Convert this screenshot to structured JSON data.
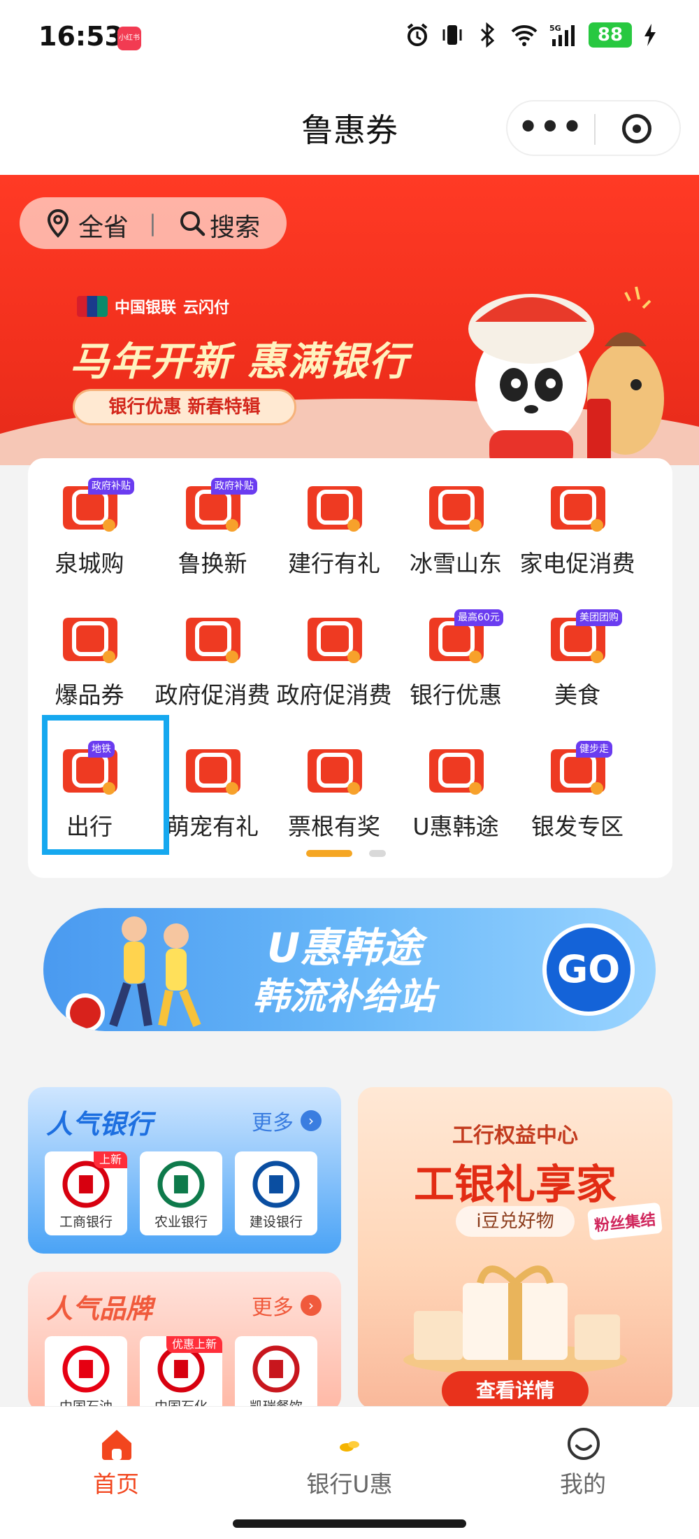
{
  "status_bar": {
    "time": "16:53",
    "app_badge": "小红书",
    "battery": "88",
    "network": "5G"
  },
  "header": {
    "title": "鲁惠券",
    "more_label": "•••"
  },
  "banner": {
    "location_label": "全省",
    "divider": "|",
    "search_label": "搜索",
    "logo_text_1": "中国银联",
    "logo_text_2": "云闪付",
    "main_text": "马年开新 惠满银行",
    "sub_text": "银行优惠 新春特辑"
  },
  "grid": {
    "items": [
      {
        "label": "泉城购",
        "badge": "政府补贴",
        "icon": "voucher-icon"
      },
      {
        "label": "鲁换新",
        "badge": "政府补贴",
        "icon": "voucher-icon"
      },
      {
        "label": "建行有礼",
        "badge": "",
        "icon": "ccb-icon"
      },
      {
        "label": "冰雪山东",
        "badge": "",
        "icon": "ski-icon"
      },
      {
        "label": "家电促消费",
        "badge": "",
        "icon": "appliance-icon"
      },
      {
        "label": "爆品券",
        "badge": "",
        "icon": "coupon-icon"
      },
      {
        "label": "政府促消费",
        "badge": "",
        "icon": "government-icon"
      },
      {
        "label": "政府促消费",
        "badge": "",
        "icon": "government-icon"
      },
      {
        "label": "银行优惠",
        "badge": "最高60元",
        "icon": "bank-card-icon"
      },
      {
        "label": "美食",
        "badge": "美团团购",
        "icon": "food-icon"
      },
      {
        "label": "出行",
        "badge": "地铁",
        "icon": "metro-icon"
      },
      {
        "label": "萌宠有礼",
        "badge": "",
        "icon": "pet-icon"
      },
      {
        "label": "票根有奖",
        "badge": "",
        "icon": "ticket-icon"
      },
      {
        "label": "U惠韩途",
        "badge": "",
        "icon": "korea-tag-icon"
      },
      {
        "label": "银发专区",
        "badge": "健步走",
        "icon": "elderly-icon"
      }
    ],
    "page_count": 2,
    "current_page": 1
  },
  "promo": {
    "line1": "U惠韩途",
    "line2": "韩流补给站",
    "go_label": "GO"
  },
  "popular_banks": {
    "title": "人气银行",
    "more": "更多",
    "items": [
      {
        "label": "工商银行",
        "badge": "上新",
        "color": "#d7000f"
      },
      {
        "label": "农业银行",
        "badge": "",
        "color": "#0e7a4b"
      },
      {
        "label": "建设银行",
        "badge": "",
        "color": "#0a4ea1"
      }
    ]
  },
  "popular_brands": {
    "title": "人气品牌",
    "more": "更多",
    "items": [
      {
        "label": "中国石油",
        "badge": "",
        "color": "#e60012"
      },
      {
        "label": "中国石化",
        "badge": "优惠上新",
        "color": "#d7000f"
      },
      {
        "label": "凯瑞餐饮",
        "badge": "",
        "color": "#c8161d"
      }
    ]
  },
  "icbc_promo": {
    "top": "工行权益中心",
    "main": "工银礼享家",
    "sub": "i豆兑好物",
    "fans": "粉丝集结",
    "button": "查看详情"
  },
  "bottom_nav": {
    "items": [
      {
        "label": "首页",
        "active": true
      },
      {
        "label": "银行U惠",
        "active": false
      },
      {
        "label": "我的",
        "active": false
      }
    ]
  },
  "colors": {
    "accent": "#f2461e",
    "selected_outline": "#16a8ef",
    "banner_red": "#f2301d"
  }
}
